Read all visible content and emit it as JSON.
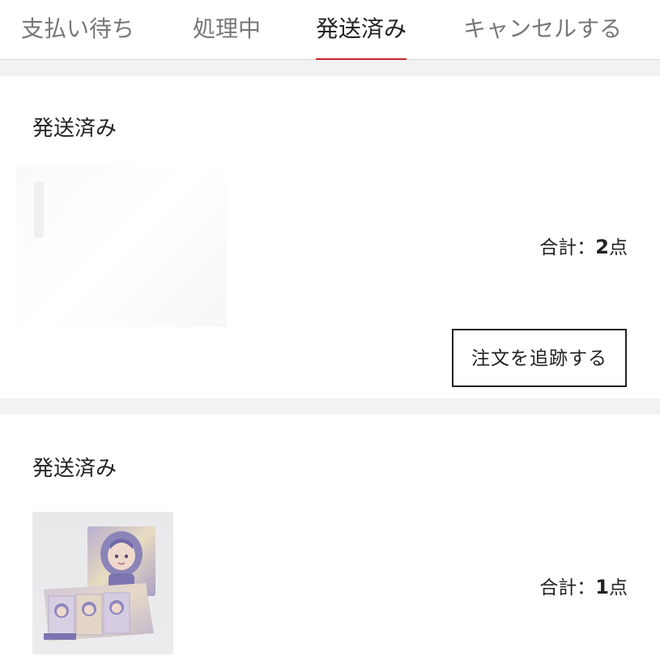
{
  "tabs": [
    {
      "label": "支払い待ち",
      "active": false
    },
    {
      "label": "処理中",
      "active": false
    },
    {
      "label": "発送済み",
      "active": true
    },
    {
      "label": "キャンセルする",
      "active": false
    }
  ],
  "colors": {
    "accent": "#c4262d",
    "background": "#f2f2f2",
    "card": "#ffffff"
  },
  "orders": [
    {
      "status": "発送済み",
      "total_prefix": "合計：",
      "total_count": "2",
      "total_unit": "点",
      "track_button": "注文を追跡する"
    },
    {
      "status": "発送済み",
      "total_prefix": "合計：",
      "total_count": "1",
      "total_unit": "点"
    }
  ]
}
